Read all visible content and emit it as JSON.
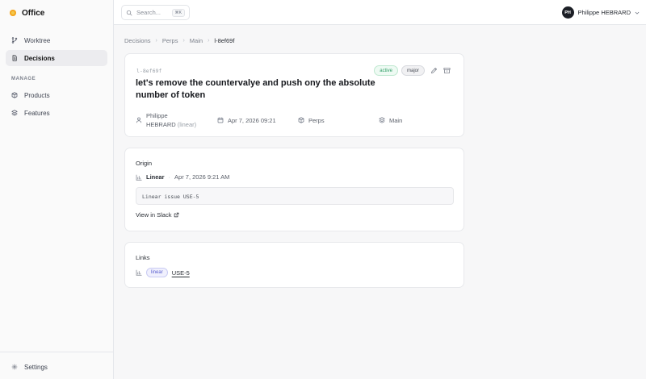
{
  "app": {
    "name": "Office"
  },
  "sidebar": {
    "items": [
      {
        "label": "Worktree",
        "icon": "git-branch-icon"
      },
      {
        "label": "Decisions",
        "icon": "document-icon",
        "active": true
      }
    ],
    "section_label": "MANAGE",
    "manage_items": [
      {
        "label": "Products",
        "icon": "box-icon"
      },
      {
        "label": "Features",
        "icon": "layers-icon"
      }
    ],
    "footer": {
      "label": "Settings",
      "icon": "gear-icon"
    }
  },
  "topbar": {
    "search_placeholder": "Search...",
    "search_shortcut": "⌘K",
    "user": {
      "initials": "PH",
      "name": "Philippe HEBRARD"
    }
  },
  "breadcrumb": [
    "Decisions",
    "Perps",
    "Main",
    "l-8ef69f"
  ],
  "decision": {
    "id": "l-8ef69f",
    "title": "let's remove the countervalye and push ony the absolute number of token",
    "status": "active",
    "severity": "major",
    "author_name": "Philippe",
    "author_rest": "HEBRARD",
    "author_source": "(linear)",
    "date": "Apr 7, 2026 09:21",
    "project": "Perps",
    "branch": "Main"
  },
  "origin": {
    "heading": "Origin",
    "source": "Linear",
    "separator": "·",
    "timestamp": "Apr 7, 2026 9:21 AM",
    "content": "Linear issue USE-5",
    "slack_label": "View in Slack"
  },
  "links": {
    "heading": "Links",
    "items": [
      {
        "badge": "linear",
        "label": "USE-5"
      }
    ]
  },
  "colors": {
    "active_green": "#2f9e66",
    "linear_purple": "#5a5fcf",
    "brand_yellow": "#f2c94c"
  }
}
